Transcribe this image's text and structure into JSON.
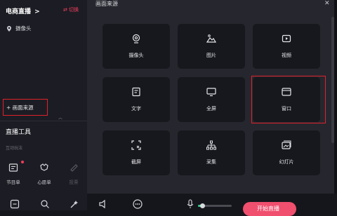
{
  "header": {
    "mode_label": "电商直播",
    "mode_chevron": ">",
    "switch_label": "切换"
  },
  "sources": {
    "items": [
      "摄像头"
    ],
    "add_button": "+ 画面来源"
  },
  "tools": {
    "section_title": "直播工具",
    "subsection": "互动玩法",
    "items": [
      {
        "label": "节目单",
        "icon": "program-list-icon",
        "badge": true
      },
      {
        "label": "心愿单",
        "icon": "wish-list-icon"
      },
      {
        "label": "投票",
        "icon": "vote-icon",
        "disabled": true
      }
    ]
  },
  "modal": {
    "title": "画面来源",
    "close": "✕",
    "options": [
      {
        "label": "摄像头",
        "icon": "camera-icon"
      },
      {
        "label": "图片",
        "icon": "image-icon"
      },
      {
        "label": "视频",
        "icon": "video-icon"
      },
      {
        "label": "文字",
        "icon": "text-icon"
      },
      {
        "label": "全屏",
        "icon": "fullscreen-icon"
      },
      {
        "label": "窗口",
        "icon": "window-icon"
      },
      {
        "label": "截屏",
        "icon": "screenshot-icon"
      },
      {
        "label": "采集",
        "icon": "capture-icon"
      },
      {
        "label": "幻灯片",
        "icon": "slideshow-icon"
      }
    ]
  },
  "bottom": {
    "start_label": "开始直播",
    "mic_level": 0.12
  },
  "colors": {
    "accent": "#f23d5c",
    "highlight": "#e0202b",
    "card": "#17181d",
    "modal": "#26272e"
  }
}
